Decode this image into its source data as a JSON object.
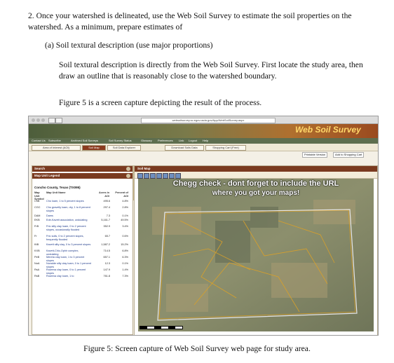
{
  "document": {
    "item_2": "2. Once your watershed is delineated, use the Web Soil Survey to estimate the soil properties on the watershed. As a minimum, prepare estimates of",
    "item_2a": "(a) Soil textural description (use major proportions)",
    "para_1": "Soil textural description is directly from the Web Soil Survey. First locate the study area, then draw an outline that is reasonably close to the watershed boundary.",
    "para_2": "Figure 5 is a screen capture depicting the result of the process.",
    "caption": "Figure 5: Screen capture of Web Soil Survey web page for study area."
  },
  "screenshot": {
    "url": "websoilsurvey.sc.egov.usda.gov/App/WebSoilSurvey.aspx",
    "logo_text": "Web Soil Survey",
    "nav_items": [
      "Contact Us",
      "Subscribe",
      "Archived Soil Surveys",
      "Soil Survey Status",
      "Glossary",
      "Preferences",
      "Link",
      "Logout",
      "Help"
    ],
    "tabs": [
      "Area of Interest (AOI)",
      "Soil Map",
      "Soil Data Explorer",
      "Download Soils Data",
      "Shopping Cart (Free)"
    ],
    "active_tab": "Soil Map",
    "mini_buttons": [
      "Printable Version",
      "Add to Shopping Cart"
    ],
    "panels": {
      "search": "Search",
      "legend": "Map Unit Legend",
      "map": "Soil Map"
    },
    "county_header": "Concho County, Texas (TX095)",
    "columns": {
      "symbol": "Map Unit Symbol",
      "name": "Map Unit Name",
      "acres": "Acres in AOI",
      "percent": "Percent of AOI"
    },
    "rows": [
      {
        "sym": "ChB",
        "name": "Cho loam, 1 to 5 percent slopes",
        "acres": "495.6",
        "pct": "4.8%"
      },
      {
        "sym": "CGC",
        "name": "Cho gravelly loam, dry, 1 to 8 percent slopes",
        "acres": "297.4",
        "pct": "2.8%"
      },
      {
        "sym": "DAM",
        "name": "Dams",
        "acres": "7.3",
        "pct": "0.1%"
      },
      {
        "sym": "EKB",
        "name": "Ede-Kavett association, undulating",
        "acres": "5,161.7",
        "pct": "49.5%"
      },
      {
        "sym": "FrB",
        "name": "Frio silty clay loam, 0 to 2 percent slopes, occasionally flooded",
        "acres": "352.9",
        "pct": "3.4%"
      },
      {
        "sym": "Fr",
        "name": "Frio soils, 0 to 2 percent slopes, frequently flooded",
        "acres": "65.7",
        "pct": "0.6%"
      },
      {
        "sym": "KtB",
        "name": "Kavett silty clay, 0 to 3 percent slopes",
        "acres": "1,587.2",
        "pct": "15.2%"
      },
      {
        "sym": "KXB",
        "name": "Kavett-Chic-Ophir complex, undulating",
        "acres": "714.5",
        "pct": "6.8%"
      },
      {
        "sym": "PeB",
        "name": "Mereta clay loam, 1 to 3 percent slopes",
        "acres": "657.1",
        "pct": "6.3%"
      },
      {
        "sym": "NuA",
        "name": "Nuvalde silty clay loam, 0 to 1 percent slopes",
        "acres": "12.3",
        "pct": "0.1%"
      },
      {
        "sym": "RsA",
        "name": "Rowena clay loam, 0 to 1 percent slopes",
        "acres": "147.9",
        "pct": "1.4%"
      },
      {
        "sym": "RsB",
        "name": "Rowena clay loam, 1 to",
        "acres": "761.8",
        "pct": "7.3%"
      }
    ],
    "overlay_line_1": "Chegg check - dont forget to include the URL",
    "overlay_line_2": "where you got your maps!"
  }
}
